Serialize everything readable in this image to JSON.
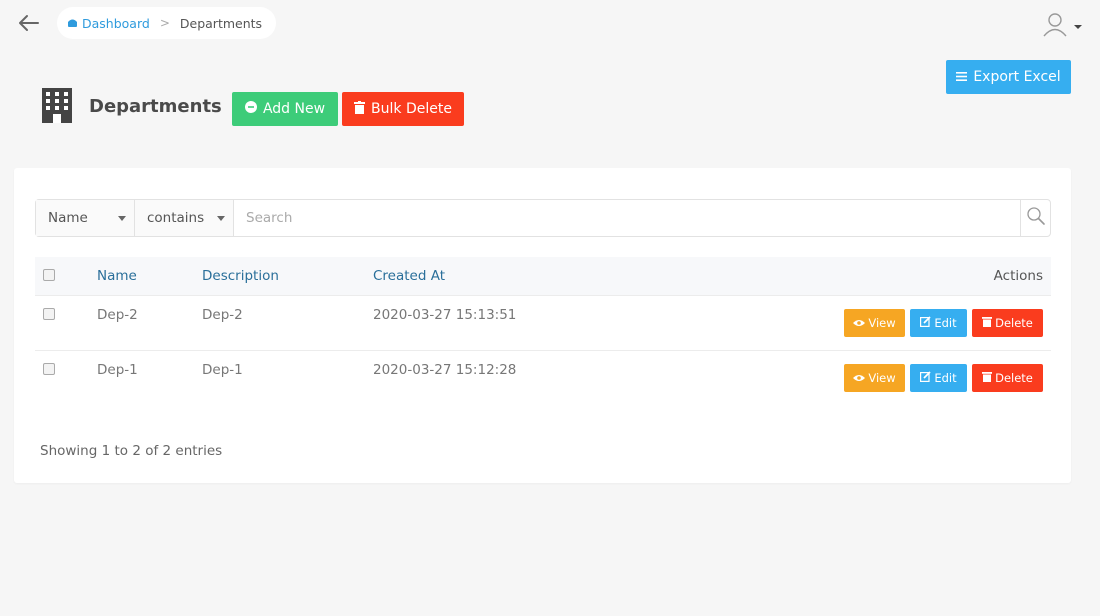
{
  "breadcrumb": {
    "home": "Dashboard",
    "separator": ">",
    "current": "Departments"
  },
  "page": {
    "title": "Departments",
    "add_label": "Add New",
    "bulk_delete_label": "Bulk Delete",
    "export_label": "Export Excel"
  },
  "filter": {
    "field_value": "Name",
    "operator_value": "contains",
    "search_placeholder": "Search"
  },
  "table": {
    "headers": {
      "name": "Name",
      "description": "Description",
      "created_at": "Created At",
      "actions": "Actions"
    },
    "action_labels": {
      "view": "View",
      "edit": "Edit",
      "delete": "Delete"
    },
    "rows": [
      {
        "name": "Dep-2",
        "description": "Dep-2",
        "created_at": "2020-03-27 15:13:51"
      },
      {
        "name": "Dep-1",
        "description": "Dep-1",
        "created_at": "2020-03-27 15:12:28"
      }
    ]
  },
  "footer": {
    "info": "Showing 1 to 2 of 2 entries"
  },
  "colors": {
    "add": "#3dcc79",
    "danger": "#fa3c1e",
    "info": "#36aef0",
    "warning": "#f6a623",
    "link": "#2f9bdd"
  }
}
